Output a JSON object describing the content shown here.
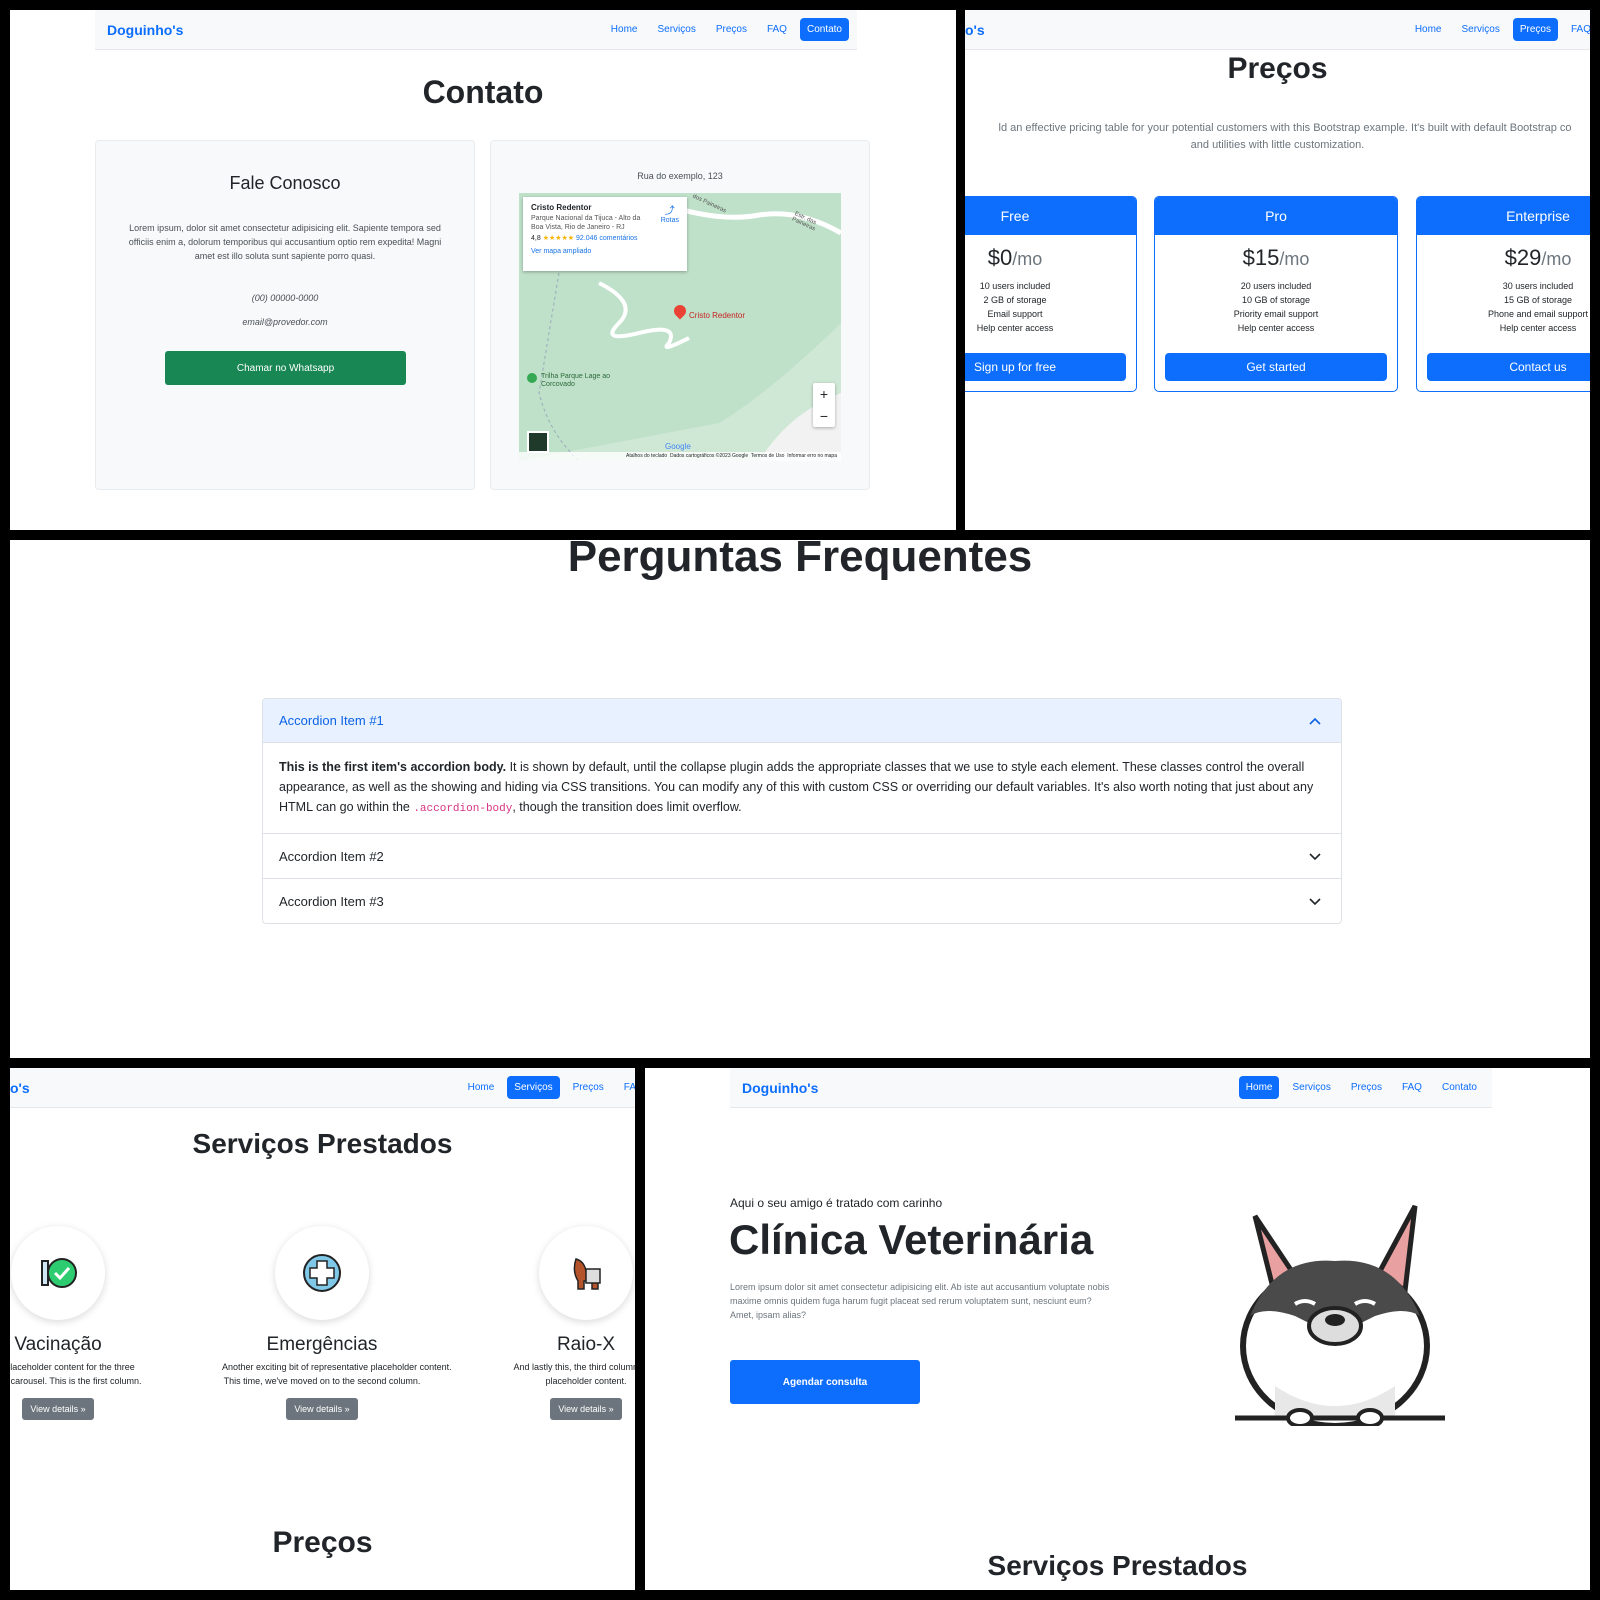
{
  "nav": {
    "brand": "Doguinho's",
    "brand_partial": "o's",
    "home": "Home",
    "servicos": "Serviços",
    "precos": "Preços",
    "faq": "FAQ",
    "contato": "Contato",
    "faq_partial": "FAQ",
    "faq_partial2": "FA"
  },
  "contato": {
    "title": "Contato",
    "card_title": "Fale Conosco",
    "text": "Lorem ipsum, dolor sit amet consectetur adipisicing elit. Sapiente tempora sed officiis enim a, dolorum temporibus qui accusantium optio rem expedita! Magni amet est illo soluta sunt sapiente porro quasi.",
    "phone": "(00) 00000-0000",
    "email": "email@provedor.com",
    "whatsapp_button": "Chamar no Whatsapp",
    "address": "Rua do exemplo, 123",
    "map": {
      "place_name": "Cristo Redentor",
      "place_address": "Parque Nacional da Tijuca - Alto da Boa Vista, Rio de Janeiro - RJ",
      "rating": "4,8",
      "stars": "★★★★★",
      "reviews": "92.046 comentários",
      "larger_map": "Ver mapa ampliado",
      "routes": "Rotas",
      "pin_label": "Cristo Redentor",
      "trail_label": "Trilha Parque Lage ao Corcovado",
      "road_label_1": "dos Paineiras",
      "road_label_2": "Estr. das Paineiras",
      "zoom_in": "+",
      "zoom_out": "−",
      "google": "Google",
      "footer_keys": "Atalhos do teclado",
      "footer_data": "Dados cartográficos ©2023 Google",
      "footer_terms": "Termos de Uso",
      "footer_report": "Informar erro no mapa"
    }
  },
  "precos": {
    "title": "Preços",
    "lead_1": "ld an effective pricing table for your potential customers with this Bootstrap example. It's built with default Bootstrap co",
    "lead_2": "and utilities with little customization.",
    "plans": [
      {
        "name": "Free",
        "price": "$0",
        "per": "/mo",
        "features": [
          "10 users included",
          "2 GB of storage",
          "Email support",
          "Help center access"
        ],
        "button": "Sign up for free"
      },
      {
        "name": "Pro",
        "price": "$15",
        "per": "/mo",
        "features": [
          "20 users included",
          "10 GB of storage",
          "Priority email support",
          "Help center access"
        ],
        "button": "Get started"
      },
      {
        "name": "Enterprise",
        "price": "$29",
        "per": "/mo",
        "features": [
          "30 users included",
          "15 GB of storage",
          "Phone and email support",
          "Help center access"
        ],
        "button": "Contact us"
      }
    ]
  },
  "faq": {
    "title": "Perguntas Frequentes",
    "items": [
      {
        "label": "Accordion Item #1"
      },
      {
        "label": "Accordion Item #2"
      },
      {
        "label": "Accordion Item #3"
      }
    ],
    "body_strong": "This is the first item's accordion body.",
    "body_text_1": " It is shown by default, until the collapse plugin adds the appropriate classes that we use to style each element. These classes control the overall appearance, as well as the showing and hiding via CSS transitions. You can modify any of this with custom CSS or overriding our default variables. It's also worth noting that just about any HTML can go within the ",
    "body_code": ".accordion-body",
    "body_text_2": ", though the transition does limit overflow."
  },
  "servicos": {
    "title": "Serviços Prestados",
    "items": [
      {
        "name": "Vacinação",
        "line1": "tative placeholder content for the three",
        "line2": "elow the carousel. This is the first column.",
        "button": "View details »"
      },
      {
        "name": "Emergências",
        "line1": "Another exciting bit of representative placeholder content.",
        "line2": "This time, we've moved on to the second column.",
        "button": "View details »"
      },
      {
        "name": "Raio-X",
        "line1": "And lastly this, the third column of re",
        "line2": "placeholder content.",
        "button": "View details »"
      }
    ],
    "next_section": "Preços"
  },
  "home": {
    "tagline": "Aqui o seu amigo é tratado com carinho",
    "title": "Clínica Veterinária",
    "text": "Lorem ipsum dolor sit amet consectetur adipisicing elit. Ab iste aut accusantium voluptate nobis maxime omnis quidem fuga harum fugit placeat sed rerum voluptatem sunt, nesciunt eum? Amet, ipsam alias?",
    "button": "Agendar consulta",
    "next_section": "Serviços Prestados"
  },
  "colors": {
    "primary": "#0d6efd",
    "success": "#198754",
    "secondary": "#6c757d"
  }
}
